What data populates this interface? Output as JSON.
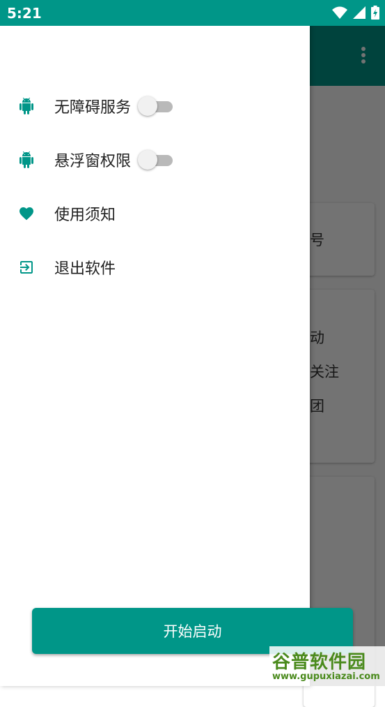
{
  "status_bar": {
    "time": "5:21"
  },
  "background": {
    "texts": [
      "号",
      "动",
      "关注",
      "团"
    ]
  },
  "drawer": {
    "items": [
      {
        "icon": "android-icon",
        "label": "无障碍服务",
        "toggle": true,
        "on": false
      },
      {
        "icon": "android-icon",
        "label": "悬浮窗权限",
        "toggle": true,
        "on": false
      },
      {
        "icon": "heart-icon",
        "label": "使用须知"
      },
      {
        "icon": "exit-icon",
        "label": "退出软件"
      }
    ]
  },
  "start_button": {
    "label": "开始启动"
  },
  "watermark": {
    "title": "谷普软件园",
    "url": "www.gupuxiazai.com"
  },
  "colors": {
    "primary": "#009688",
    "toggle_track_off": "#b9b9b9",
    "toggle_thumb_off": "#f1f1f1"
  }
}
